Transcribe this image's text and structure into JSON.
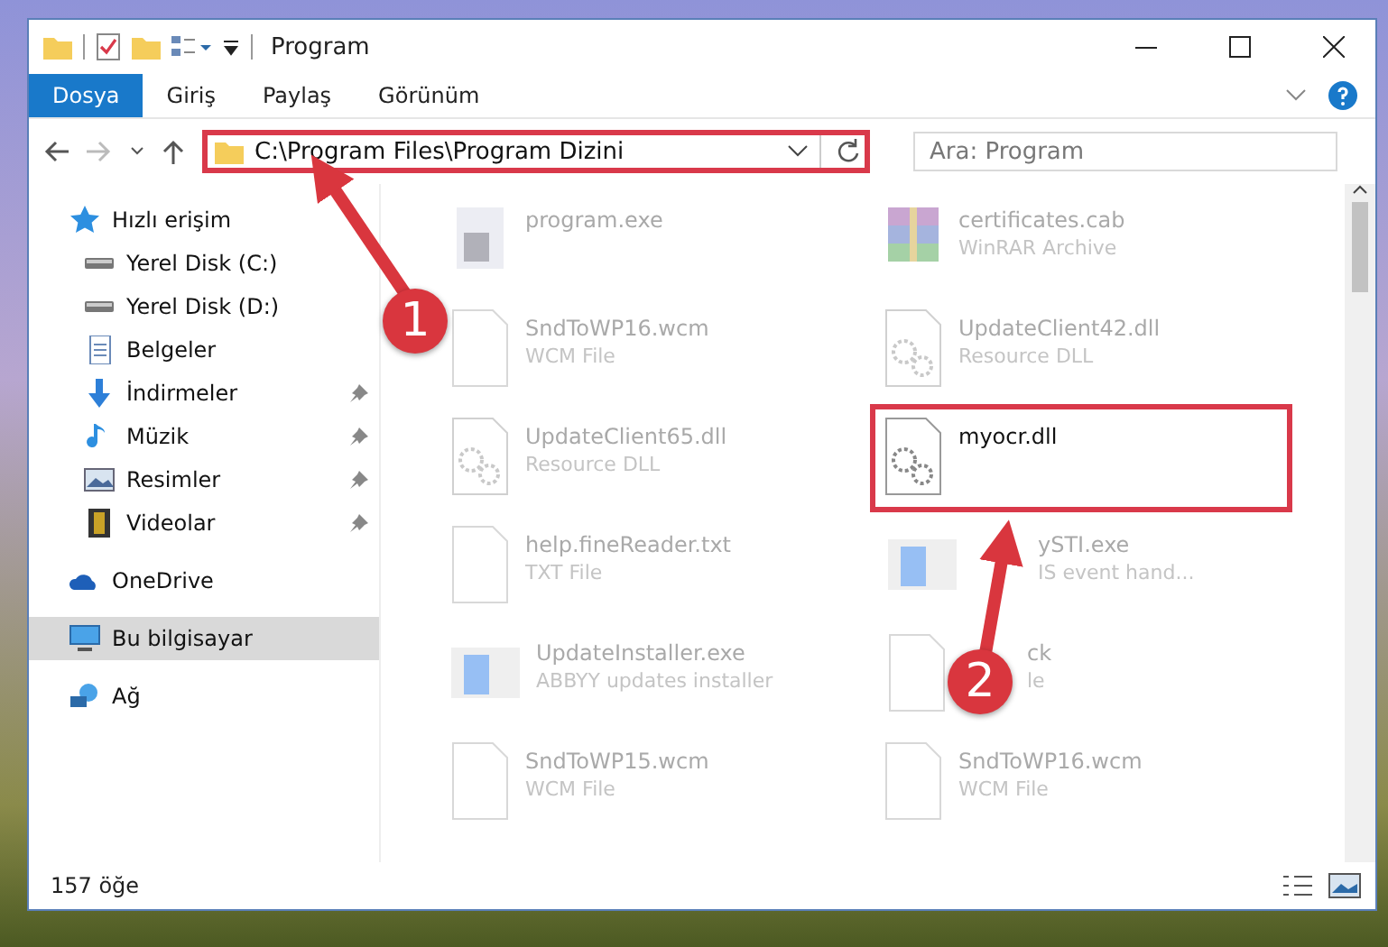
{
  "window": {
    "title": "Program"
  },
  "ribbon_tabs": [
    {
      "label": "Dosya",
      "selected": true
    },
    {
      "label": "Giriş",
      "selected": false
    },
    {
      "label": "Paylaş",
      "selected": false
    },
    {
      "label": "Görünüm",
      "selected": false
    }
  ],
  "address_bar": {
    "path": "C:\\Program Files\\Program Dizini",
    "highlighted": true
  },
  "search": {
    "placeholder": "Ara: Program"
  },
  "sidebar": {
    "items": [
      {
        "label": "Hızlı erişim",
        "kind": "star",
        "selected": false,
        "children": [
          {
            "label": "Yerel Disk (C:)",
            "kind": "disk",
            "pinned": false,
            "selected": false
          },
          {
            "label": "Yerel Disk (D:)",
            "kind": "disk",
            "pinned": false,
            "selected": false
          },
          {
            "label": "Belgeler",
            "kind": "docs",
            "pinned": false,
            "selected": false
          },
          {
            "label": "İndirmeler",
            "kind": "download",
            "pinned": true,
            "selected": false
          },
          {
            "label": "Müzik",
            "kind": "music",
            "pinned": true,
            "selected": false
          },
          {
            "label": "Resimler",
            "kind": "pictures",
            "pinned": true,
            "selected": false
          },
          {
            "label": "Videolar",
            "kind": "video",
            "pinned": true,
            "selected": false
          }
        ]
      },
      {
        "label": "OneDrive",
        "kind": "cloud",
        "selected": false
      },
      {
        "label": "Bu bilgisayar",
        "kind": "pc",
        "selected": true
      },
      {
        "label": "Ağ",
        "kind": "network",
        "selected": false
      }
    ]
  },
  "files": [
    {
      "name": "program.exe",
      "kind": "exe",
      "highlighted": false
    },
    {
      "name": "certificates.cab",
      "type": "WinRAR Archive",
      "kind": "archive",
      "highlighted": false
    },
    {
      "name": "SndToWP16.wcm",
      "type": "WCM File",
      "kind": "blank",
      "highlighted": false
    },
    {
      "name": "UpdateClient42.dll",
      "type": "Resource DLL",
      "kind": "dll",
      "highlighted": false
    },
    {
      "name": "UpdateClient65.dll",
      "type": "Resource DLL",
      "kind": "dll",
      "highlighted": false
    },
    {
      "name": "myocr.dll",
      "kind": "dll",
      "highlighted": true
    },
    {
      "name": "help.fineReader.txt",
      "type": "TXT File",
      "kind": "blank",
      "highlighted": false
    },
    {
      "name": "ySTI.exe",
      "type": "IS event hand...",
      "kind": "installer",
      "highlighted": false,
      "covered": true
    },
    {
      "name": "UpdateInstaller.exe",
      "type": "ABBYY updates installer",
      "kind": "installer",
      "highlighted": false
    },
    {
      "name": "ck",
      "type": "le",
      "kind": "blank",
      "highlighted": false,
      "covered": true
    },
    {
      "name": "SndToWP15.wcm",
      "type": "WCM File",
      "kind": "blank",
      "highlighted": false
    },
    {
      "name": "SndToWP16.wcm",
      "type": "WCM File",
      "kind": "blank",
      "highlighted": false
    }
  ],
  "status_bar": {
    "count": "157 öğe"
  },
  "annotations": [
    {
      "number": "1"
    },
    {
      "number": "2"
    }
  ]
}
